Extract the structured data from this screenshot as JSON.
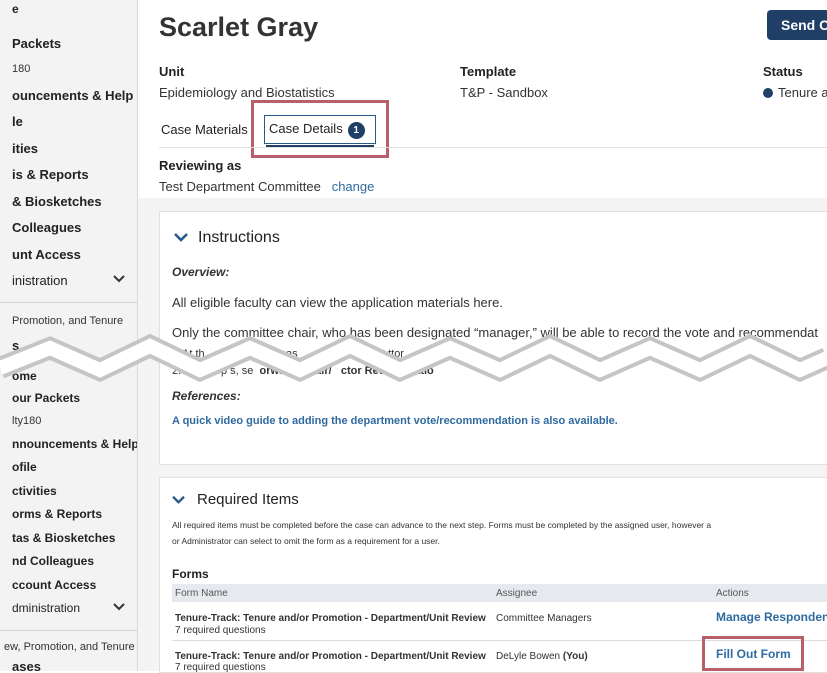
{
  "sidebar_top": {
    "items": [
      {
        "label": "e"
      },
      {
        "label": "Packets"
      },
      {
        "label": "180"
      },
      {
        "label": "ouncements & Help"
      },
      {
        "label": "le"
      },
      {
        "label": "ities"
      },
      {
        "label": "is & Reports"
      },
      {
        "label": "& Biosketches"
      },
      {
        "label": "Colleagues"
      },
      {
        "label": "unt Access"
      },
      {
        "label": "inistration"
      }
    ],
    "section": "Promotion, and Tenure",
    "section_next": "s"
  },
  "sidebar_bottom": {
    "items": [
      {
        "label": "ome"
      },
      {
        "label": "our Packets"
      },
      {
        "label": "lty180"
      },
      {
        "label": "nnouncements & Help"
      },
      {
        "label": "ofile"
      },
      {
        "label": "ctivities"
      },
      {
        "label": "orms & Reports"
      },
      {
        "label": "tas & Biosketches"
      },
      {
        "label": "nd Colleagues"
      },
      {
        "label": "ccount Access"
      },
      {
        "label": "dministration"
      }
    ],
    "section": "ew, Promotion, and Tenure",
    "section_next": "ases"
  },
  "header": {
    "name": "Scarlet Gray",
    "send_button": "Send C"
  },
  "meta": {
    "unit_label": "Unit",
    "unit_value": "Epidemiology and Biostatistics",
    "template_label": "Template",
    "template_value": "T&P - Sandbox",
    "status_label": "Status",
    "status_value": "Tenure a"
  },
  "tabs": {
    "materials": "Case Materials",
    "details": "Case Details",
    "details_badge": "1"
  },
  "reviewing": {
    "label": "Reviewing as",
    "value": "Test Department Committee",
    "change": "change"
  },
  "instructions": {
    "title": "Instructions",
    "overview_label": "Overview:",
    "line1": "All eligible faculty can view the application materials here.",
    "line2": "Only the committee chair, who has been designated “manager,” will be able to record the vote and recommendat",
    "frag1a": "At th",
    "frag1b": "at the",
    "frag1c": "y me",
    "frag1d": "cas",
    "frag1e": "clic",
    "frag1f": "nd",
    "frag1g": "ttor",
    "frag2a": "2.",
    "frag2b": "n the op",
    "frag2c": "s, se",
    "frag2d": "orward",
    "frag2e": "hair/",
    "frag2f": "ctor Reco",
    "frag2g": "endatio",
    "references_label": "References:",
    "ref_link": "A quick video guide to adding the department vote/recommendation is also available."
  },
  "required": {
    "title": "Required Items",
    "desc1": "All required items must be completed before the case can advance to the next step. Forms must be completed by the assigned user, however a",
    "desc2": "or Administrator can select to omit the form as a requirement for a user.",
    "forms_label": "Forms",
    "columns": [
      "Form Name",
      "Assignee",
      "Actions"
    ],
    "rows": [
      {
        "name": "Tenure-Track: Tenure and/or Promotion - Department/Unit Review",
        "sub": "7 required questions",
        "assignee": "Committee Managers",
        "you": "",
        "action": "Manage Respondent"
      },
      {
        "name": "Tenure-Track: Tenure and/or Promotion - Department/Unit Review",
        "sub": "7 required questions",
        "assignee": "DeLyle Bowen",
        "you": "(You)",
        "action": "Fill Out Form"
      }
    ]
  },
  "colors": {
    "accent": "#1f3f66",
    "highlight": "#b5606a",
    "link": "#2f6aa0"
  }
}
